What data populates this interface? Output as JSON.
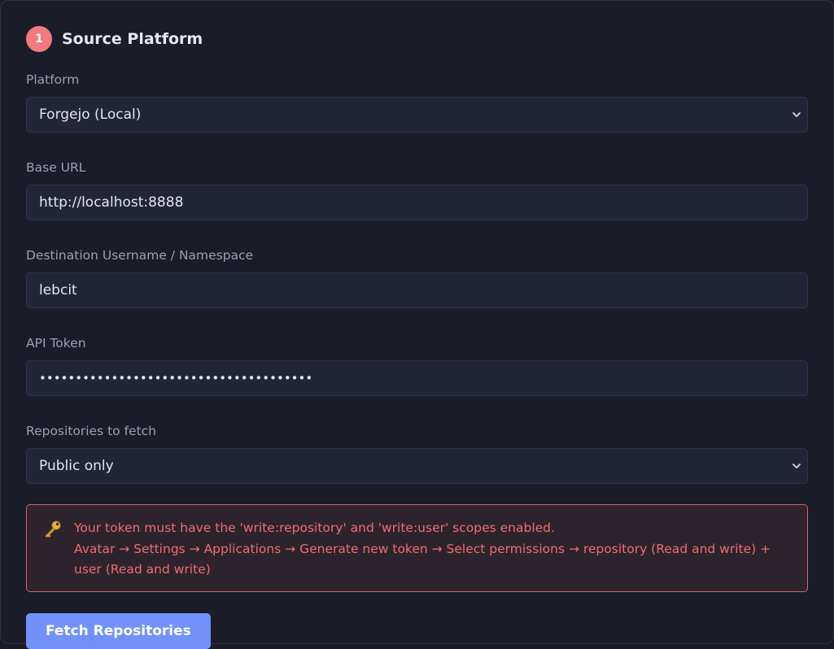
{
  "header": {
    "step_number": "1",
    "title": "Source Platform"
  },
  "platform": {
    "label": "Platform",
    "value": "Forgejo (Local)"
  },
  "base_url": {
    "label": "Base URL",
    "value": "http://localhost:8888"
  },
  "destination": {
    "label": "Destination Username / Namespace",
    "value": "lebcit"
  },
  "api_token": {
    "label": "API Token",
    "masked_value": "••••••••••••••••••••••••••••••••••••••"
  },
  "repositories": {
    "label": "Repositories to fetch",
    "value": "Public only"
  },
  "alert": {
    "icon": "key-icon",
    "line1": "Your token must have the 'write:repository' and 'write:user' scopes enabled.",
    "line2": "Avatar → Settings → Applications → Generate new token → Select permissions → repository (Read and write) + user (Read and write)"
  },
  "actions": {
    "fetch_label": "Fetch Repositories"
  },
  "colors": {
    "accent": "#7391fb",
    "badge": "#f27a7d",
    "alert_text": "#ef6d70",
    "alert_border": "#d9636b"
  }
}
